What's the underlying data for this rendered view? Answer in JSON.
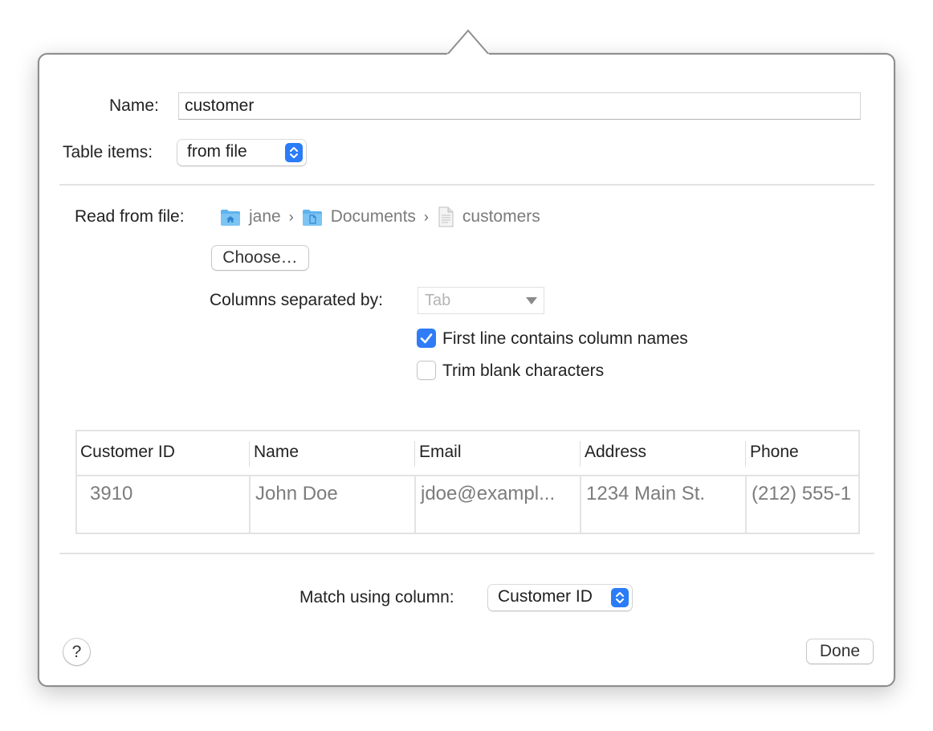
{
  "form": {
    "name_label": "Name:",
    "name_value": "customer",
    "table_items_label": "Table items:",
    "table_items_value": "from file"
  },
  "source": {
    "read_label": "Read from file:",
    "path": [
      {
        "name": "jane",
        "icon": "home-folder-icon"
      },
      {
        "name": "Documents",
        "icon": "documents-folder-icon"
      },
      {
        "name": "customers",
        "icon": "text-file-icon"
      }
    ],
    "choose_label": "Choose…",
    "separator_label": "Columns separated by:",
    "separator_value": "Tab",
    "first_line_label": "First line contains column names",
    "first_line_checked": true,
    "trim_label": "Trim blank characters",
    "trim_checked": false
  },
  "preview": {
    "columns": [
      "Customer ID",
      "Name",
      "Email",
      "Address",
      "Phone"
    ],
    "row": [
      "3910",
      "John Doe",
      "jdoe@exampl...",
      "1234 Main St.",
      "(212) 555-1"
    ]
  },
  "match": {
    "label": "Match using column:",
    "value": "Customer ID"
  },
  "footer": {
    "help_label": "?",
    "done_label": "Done"
  },
  "colors": {
    "accent": "#2f7cf6",
    "folder": "#5fb3ee"
  }
}
